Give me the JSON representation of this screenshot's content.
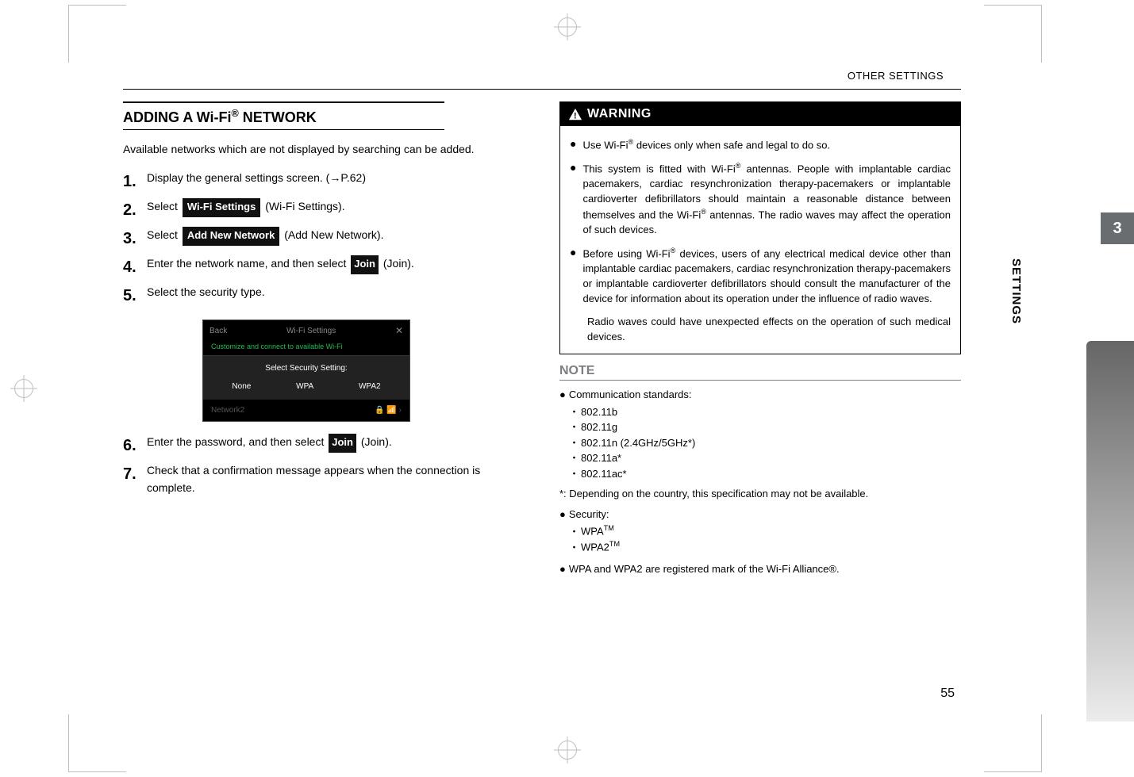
{
  "running_head": "OTHER SETTINGS",
  "chapter_tab": "3",
  "side_label": "SETTINGS",
  "page_number": "55",
  "left": {
    "heading_prefix": "ADDING A Wi-Fi",
    "heading_sup": "®",
    "heading_suffix": " NETWORK",
    "intro": "Available networks which are not displayed by searching can be added.",
    "steps": {
      "s1": {
        "num": "1.",
        "text_before": "Display the general settings screen. (",
        "link": "→P.62",
        "text_after": ")"
      },
      "s2": {
        "num": "2.",
        "text_before": "Select ",
        "chip": "Wi-Fi Settings",
        "text_after": " (Wi-Fi Settings)."
      },
      "s3": {
        "num": "3.",
        "text_before": "Select ",
        "chip": "Add New Network",
        "text_after": " (Add New Network)."
      },
      "s4": {
        "num": "4.",
        "text_before": "Enter the network name, and then select ",
        "chip": "Join",
        "text_after": " (Join)."
      },
      "s5": {
        "num": "5.",
        "text": "Select the security type."
      },
      "s6": {
        "num": "6.",
        "text_before": "Enter the password, and then select ",
        "chip": "Join",
        "text_after": " (Join)."
      },
      "s7": {
        "num": "7.",
        "text": "Check that a confirmation message appears when the connection is complete."
      }
    },
    "screenshot": {
      "back": "Back",
      "title": "Wi-Fi Settings",
      "close": "✕",
      "subtitle": "Customize and connect to available Wi-Fi",
      "select_label": "Select Security Setting:",
      "opt_none": "None",
      "opt_wpa": "WPA",
      "opt_wpa2": "WPA2",
      "row_label": "Network2",
      "row_icons": "🔒 📶 ›"
    }
  },
  "right": {
    "warning": {
      "icon": "!",
      "title": "WARNING",
      "b1_before": "Use Wi-Fi",
      "b1_sup": "®",
      "b1_after": " devices only when safe and legal to do so.",
      "b2_a": "This system is fitted with Wi-Fi",
      "b2_sup1": "®",
      "b2_b": " antennas. People with implantable cardiac pacemakers, cardiac resynchronization therapy-pacemakers or implantable cardioverter defibrillators should maintain a reasonable distance between themselves and the Wi-Fi",
      "b2_sup2": "®",
      "b2_c": " antennas. The radio waves may affect the operation of such devices.",
      "b3_a": "Before using Wi-Fi",
      "b3_sup": "®",
      "b3_b": " devices, users of any electrical medical device other than implantable cardiac pacemakers, cardiac resynchronization therapy-pacemakers or implantable cardioverter defibrillators should consult the manufacturer of the device for information about its operation under the influence of radio waves.",
      "b3_p2": "Radio waves could have unexpected effects on the operation of such medical devices."
    },
    "note": {
      "title": "NOTE",
      "l1": "Communication standards:",
      "std1": "802.11b",
      "std2": "802.11g",
      "std3": "802.11n (2.4GHz/5GHz*)",
      "std4": "802.11a*",
      "std5": "802.11ac*",
      "footnote": "*: Depending on the country, this specification may not be available.",
      "l2": "Security:",
      "sec1_base": "WPA",
      "sec1_sup": "TM",
      "sec2_base": "WPA2",
      "sec2_sup": "TM",
      "l3": "WPA and WPA2 are registered mark of the Wi-Fi Alliance®."
    }
  }
}
